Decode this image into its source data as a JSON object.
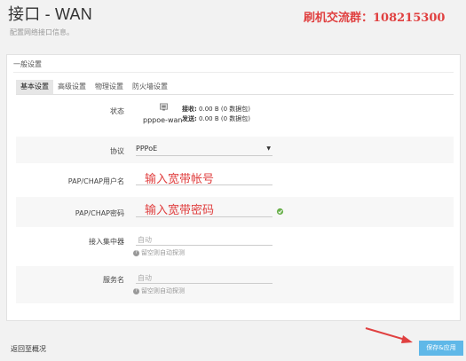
{
  "page": {
    "title": "接口 - WAN",
    "subtitle": "配置网络接口信息。"
  },
  "promo": {
    "text": "刷机交流群：108215300"
  },
  "section": {
    "legend": "一般设置",
    "tabs": [
      {
        "label": "基本设置",
        "active": true
      },
      {
        "label": "高级设置",
        "active": false
      },
      {
        "label": "物理设置",
        "active": false
      },
      {
        "label": "防火墙设置",
        "active": false
      }
    ]
  },
  "status": {
    "label": "状态",
    "interface": "pppoe-wan",
    "rx_label": "接收:",
    "rx_value": " 0.00 B (0 数据包)",
    "tx_label": "发送:",
    "tx_value": " 0.00 B (0 数据包)",
    "icon": "network-port-icon"
  },
  "protocol": {
    "label": "协议",
    "value": "PPPoE"
  },
  "username": {
    "label": "PAP/CHAP用户名",
    "value": "",
    "annotation": "输入宽带帐号"
  },
  "password": {
    "label": "PAP/CHAP密码",
    "value": "",
    "annotation": "输入宽带密码",
    "reveal_icon": "reveal-password-icon"
  },
  "concentrator": {
    "label": "接入集中器",
    "placeholder": "自动",
    "hint": "留空则自动探测"
  },
  "service": {
    "label": "服务名",
    "placeholder": "自动",
    "hint": "留空则自动探测"
  },
  "footer": {
    "back_label": "返回至概况",
    "apply_label": "保存&应用"
  },
  "colors": {
    "accent": "#5fb8e8",
    "annotation": "#e04040"
  }
}
